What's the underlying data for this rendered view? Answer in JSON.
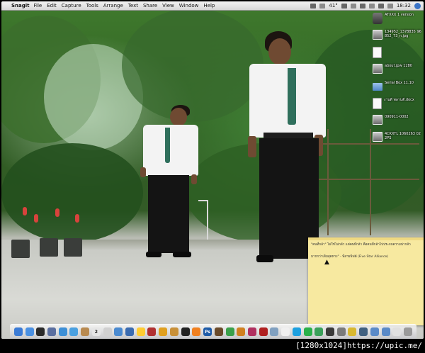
{
  "menubar": {
    "app_name": "Snagit",
    "items": [
      "File",
      "Edit",
      "Capture",
      "Tools",
      "Arrange",
      "Text",
      "Share",
      "View",
      "Window",
      "Help"
    ],
    "temperature": "41°",
    "clock": "18:32"
  },
  "desktop_icons": [
    {
      "label": "ATXXX 1 version",
      "kind": "app"
    },
    {
      "label": "134952_1378835 96852_73_n.jpg",
      "kind": "image"
    },
    {
      "label": "",
      "kind": "document"
    },
    {
      "label": "about.jpw 1280",
      "kind": "image"
    },
    {
      "label": "Serial Box 11.10",
      "kind": "folder"
    },
    {
      "label": "งานดี พลานดี.docx",
      "kind": "document"
    },
    {
      "label": "090911-0002",
      "kind": "image"
    },
    {
      "label": "4CKXTL 1060263 02 2PS",
      "kind": "image"
    }
  ],
  "sticky_note": {
    "line1": "\"คนที่กล้า\" ไม่ใช่ไม่กลัว แต่คนที่กล้า คือคนที่กล้าไปประจบความน่ากลัว",
    "line2": "มากกว่าเดิมสุดทาง\" - พี่สายพิฟต์ (Five Star Alliance)"
  },
  "dock": {
    "items": [
      {
        "icon": "finder-icon",
        "color": "#3b7bd6",
        "glyph": ""
      },
      {
        "icon": "network-icon",
        "color": "#4a90e2",
        "glyph": ""
      },
      {
        "icon": "dashboard-icon",
        "color": "#2a2a2a",
        "glyph": ""
      },
      {
        "icon": "mail-icon",
        "color": "#5a6fa0",
        "glyph": ""
      },
      {
        "icon": "safari-icon",
        "color": "#3d8fd6",
        "glyph": ""
      },
      {
        "icon": "chat-icon",
        "color": "#4aa0e0",
        "glyph": ""
      },
      {
        "icon": "addressbook-icon",
        "color": "#b88a50",
        "glyph": ""
      },
      {
        "icon": "calendar-icon",
        "color": "#e6e6e6",
        "glyph": "2"
      },
      {
        "icon": "preview-icon",
        "color": "#d0d0d0",
        "glyph": ""
      },
      {
        "icon": "itunes-icon",
        "color": "#4a8ad0",
        "glyph": ""
      },
      {
        "icon": "iphoto-icon",
        "color": "#3a6bb0",
        "glyph": ""
      },
      {
        "icon": "imovie-icon",
        "color": "#ffcc33",
        "glyph": ""
      },
      {
        "icon": "photobooth-icon",
        "color": "#b03030",
        "glyph": ""
      },
      {
        "icon": "star-icon",
        "color": "#e0a020",
        "glyph": ""
      },
      {
        "icon": "garageband-icon",
        "color": "#c89038",
        "glyph": ""
      },
      {
        "icon": "dvd-icon",
        "color": "#222222",
        "glyph": ""
      },
      {
        "icon": "vlc-icon",
        "color": "#f08020",
        "glyph": ""
      },
      {
        "icon": "photoshop-icon",
        "color": "#1e5ba8",
        "glyph": "Ps"
      },
      {
        "icon": "bridge-icon",
        "color": "#6a4a2a",
        "glyph": ""
      },
      {
        "icon": "dreamweaver-icon",
        "color": "#3aa04a",
        "glyph": ""
      },
      {
        "icon": "fireworks-icon",
        "color": "#d08020",
        "glyph": ""
      },
      {
        "icon": "flash-icon",
        "color": "#b03060",
        "glyph": ""
      },
      {
        "icon": "filezilla-icon",
        "color": "#b02020",
        "glyph": ""
      },
      {
        "icon": "sketch-icon",
        "color": "#80a0c0",
        "glyph": ""
      },
      {
        "icon": "whiteboard-icon",
        "color": "#f0f0f0",
        "glyph": ""
      },
      {
        "icon": "skype-icon",
        "color": "#1ca0e0",
        "glyph": ""
      },
      {
        "icon": "messenger-icon",
        "color": "#2ab04a",
        "glyph": ""
      },
      {
        "icon": "sync-icon",
        "color": "#3aa05a",
        "glyph": ""
      },
      {
        "icon": "camera-icon",
        "color": "#3a3a3a",
        "glyph": ""
      },
      {
        "icon": "system-prefs-icon",
        "color": "#7a7a7a",
        "glyph": ""
      },
      {
        "icon": "stickies-icon",
        "color": "#d8b830",
        "glyph": ""
      },
      {
        "icon": "image-capture-icon",
        "color": "#406080",
        "glyph": ""
      },
      {
        "icon": "downloads-folder-icon",
        "color": "#5a8ac8",
        "glyph": ""
      },
      {
        "icon": "documents-folder-icon",
        "color": "#5a8ac8",
        "glyph": ""
      },
      {
        "icon": "document-stack-icon",
        "color": "#e0e0e0",
        "glyph": ""
      },
      {
        "icon": "trash-icon",
        "color": "#9a9a9a",
        "glyph": ""
      }
    ]
  },
  "footer_text": "[1280x1024]https://upic.me/"
}
